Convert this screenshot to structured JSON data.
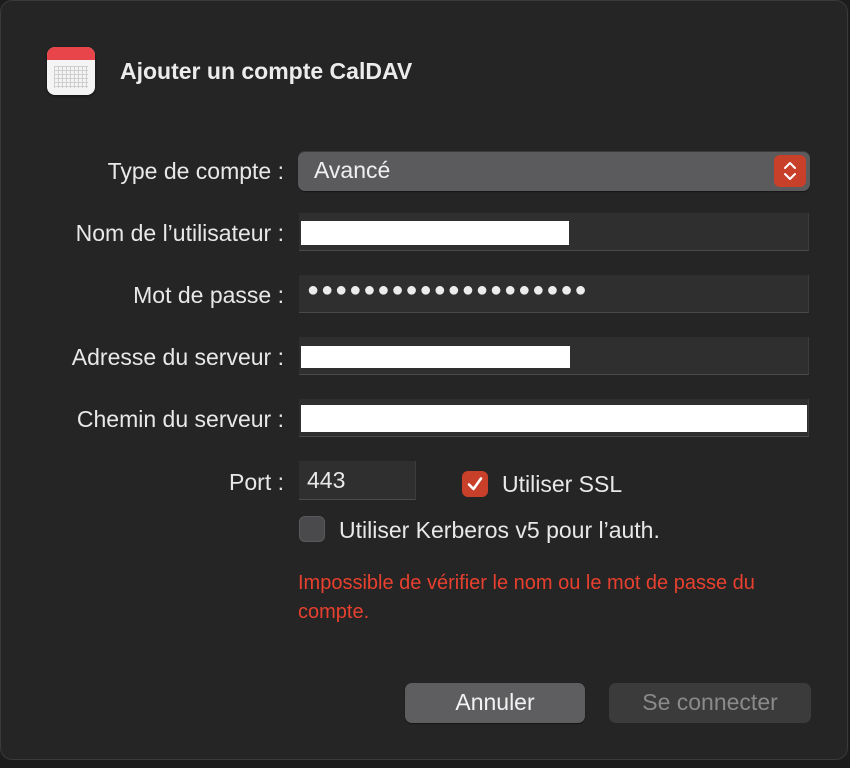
{
  "dialog": {
    "title": "Ajouter un compte CalDAV",
    "icon": "calendar-icon"
  },
  "form": {
    "account_type_label": "Type de compte :",
    "account_type_value": "Avancé",
    "username_label": "Nom de l’utilisateur :",
    "password_label": "Mot de passe :",
    "password_value": "●●●●●●●●●●●●●●●●●●●●",
    "server_address_label": "Adresse du serveur :",
    "server_path_label": "Chemin du serveur :",
    "port_label": "Port :",
    "port_value": "443",
    "ssl_label": "Utiliser SSL",
    "ssl_checked": true,
    "kerberos_label": "Utiliser Kerberos v5 pour l’auth.",
    "kerberos_checked": false
  },
  "error_message": "Impossible de vérifier le nom ou le mot de passe du compte.",
  "buttons": {
    "cancel": "Annuler",
    "connect": "Se connecter"
  },
  "colors": {
    "accent": "#c8402a",
    "error": "#e8402e",
    "background": "#252526"
  }
}
